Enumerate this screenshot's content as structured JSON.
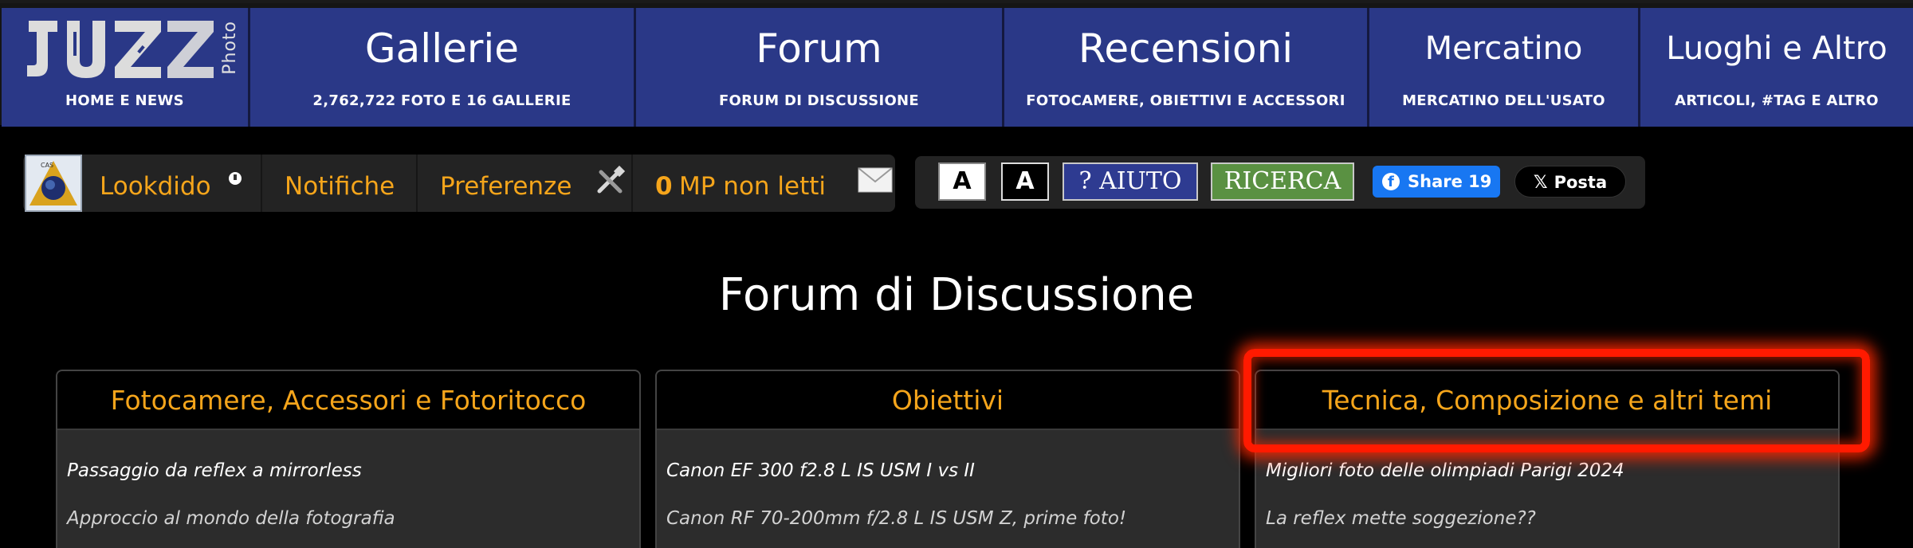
{
  "nav": {
    "home": {
      "logo": "JUZA",
      "logo_sub": "Photo",
      "sub": "HOME E NEWS"
    },
    "gallerie": {
      "title": "Gallerie",
      "sub": "2,762,722 FOTO E 16 GALLERIE"
    },
    "forum": {
      "title": "Forum",
      "sub": "FORUM DI DISCUSSIONE"
    },
    "recensioni": {
      "title": "Recensioni",
      "sub": "FOTOCAMERE, OBIETTIVI E ACCESSORI"
    },
    "mercatino": {
      "title": "Mercatino",
      "sub": "MERCATINO DELL'USATO"
    },
    "luoghi": {
      "title": "Luoghi e Altro",
      "sub": "ARTICOLI, #TAG E ALTRO"
    }
  },
  "userbar": {
    "username": "Lookdido",
    "notifiche": "Notifiche",
    "preferenze": "Preferenze",
    "mp_count": "0",
    "mp_label": "MP non letti"
  },
  "toolbar": {
    "font_light": "A",
    "font_dark": "A",
    "aiuto": "? AIUTO",
    "ricerca": "RICERCA",
    "share_label": "Share 19",
    "posta_label": "Posta"
  },
  "page": {
    "title": "Forum di Discussione"
  },
  "columns": [
    {
      "title": "Fotocamere, Accessori e Fotoritocco",
      "items": [
        "Passaggio da reflex a mirrorless",
        "Approccio al mondo della fotografia"
      ]
    },
    {
      "title": "Obiettivi",
      "items": [
        "Canon EF 300 f2.8 L IS USM I vs II",
        "Canon RF 70-200mm f/2.8 L IS USM Z, prime foto!"
      ]
    },
    {
      "title": "Tecnica, Composizione e altri temi",
      "items": [
        "Migliori foto delle olimpiadi Parigi 2024",
        "La reflex mette soggezione??"
      ]
    }
  ],
  "colors": {
    "nav_bg": "#2a3887",
    "accent_orange": "#f5a51b",
    "highlight": "#ff1a00"
  }
}
